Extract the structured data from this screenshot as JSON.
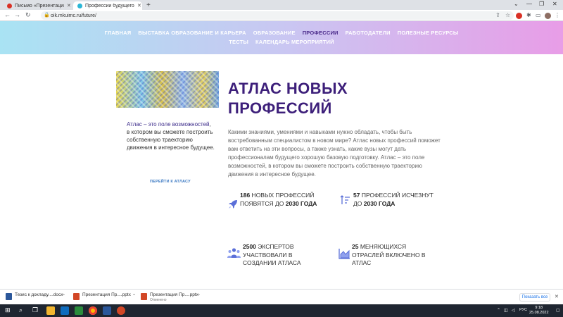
{
  "browser": {
    "tabs": [
      {
        "title": "Письмо «Презентация Профе...",
        "active": false,
        "favicon_color": "#d93025"
      },
      {
        "title": "Профессии будущего",
        "active": true,
        "favicon_color": "#29b6d6"
      }
    ],
    "url": "oik.mkuimc.ru/future/"
  },
  "site_nav": {
    "row1": [
      {
        "label": "ГЛАВНАЯ",
        "active": false
      },
      {
        "label": "ВЫСТАВКА ОБРАЗОВАНИЕ И КАРЬЕРА",
        "active": false
      },
      {
        "label": "ОБРАЗОВАНИЕ",
        "active": false
      },
      {
        "label": "ПРОФЕССИИ",
        "active": true
      },
      {
        "label": "РАБОТОДАТЕЛИ",
        "active": false
      },
      {
        "label": "ПОЛЕЗНЫЕ РЕСУРСЫ",
        "active": false
      }
    ],
    "row2": [
      {
        "label": "ТЕСТЫ",
        "active": false
      },
      {
        "label": "КАЛЕНДАРЬ МЕРОПРИЯТИЙ",
        "active": false
      }
    ]
  },
  "content": {
    "title_line1": "АТЛАС НОВЫХ",
    "title_line2": "ПРОФЕССИЙ",
    "quote_highlight": "Атлас – это поле возможностей",
    "quote_rest": ", в котором вы сможете построить собственную траекторию движения в интересное будущее.",
    "atlas_link": "ПЕРЕЙТИ К АТЛАСУ",
    "intro": "Какими знаниями, умениями и навыками нужно обладать, чтобы быть востребованным специалистом в новом мире? Атлас новых профессий поможет вам ответить на эти вопросы, а также узнать, какие вузы могут дать профессионалам будущего хорошую базовую подготовку. Атлас – это поле возможностей, в котором вы сможете построить собственную траекторию движения в интересное будущее."
  },
  "stats": [
    {
      "num": "186",
      "text": " НОВЫХ ПРОФЕССИЙ ПОЯВЯТСЯ ДО ",
      "bold_end": "2030 ГОДА",
      "icon": "rocket-icon"
    },
    {
      "num": "57",
      "text": " ПРОФЕССИЙ ИСЧЕЗНУТ ДО ",
      "bold_end": "2030 ГОДА",
      "icon": "sort-descending-icon"
    },
    {
      "num": "2500",
      "text": " ЭКСПЕРТОВ УЧАСТВОВАЛИ В СОЗДАНИИ АТЛАСА",
      "bold_end": "",
      "icon": "people-group-icon"
    },
    {
      "num": "25",
      "text": " МЕНЯЮЩИХСЯ ОТРАСЛЕЙ ВКЛЮЧЕНО В АТЛАС",
      "bold_end": "",
      "icon": "area-chart-icon"
    }
  ],
  "downloads": [
    {
      "name": "Тезис к докладу....docx",
      "sub": "",
      "color": "#2b579a"
    },
    {
      "name": "Презентация Пр....pptx",
      "sub": "",
      "color": "#d24726"
    },
    {
      "name": "Презентация Пр....pptx",
      "sub": "Отменено",
      "color": "#d24726"
    }
  ],
  "downloads_bar": {
    "show_all": "Показать все"
  },
  "taskbar": {
    "lang": "РУС",
    "time": "9:18",
    "date": "25.08.2022"
  },
  "colors": {
    "accent": "#3d1f7a",
    "link": "#3a78c2",
    "stat_icon": "#5b6fd8"
  }
}
